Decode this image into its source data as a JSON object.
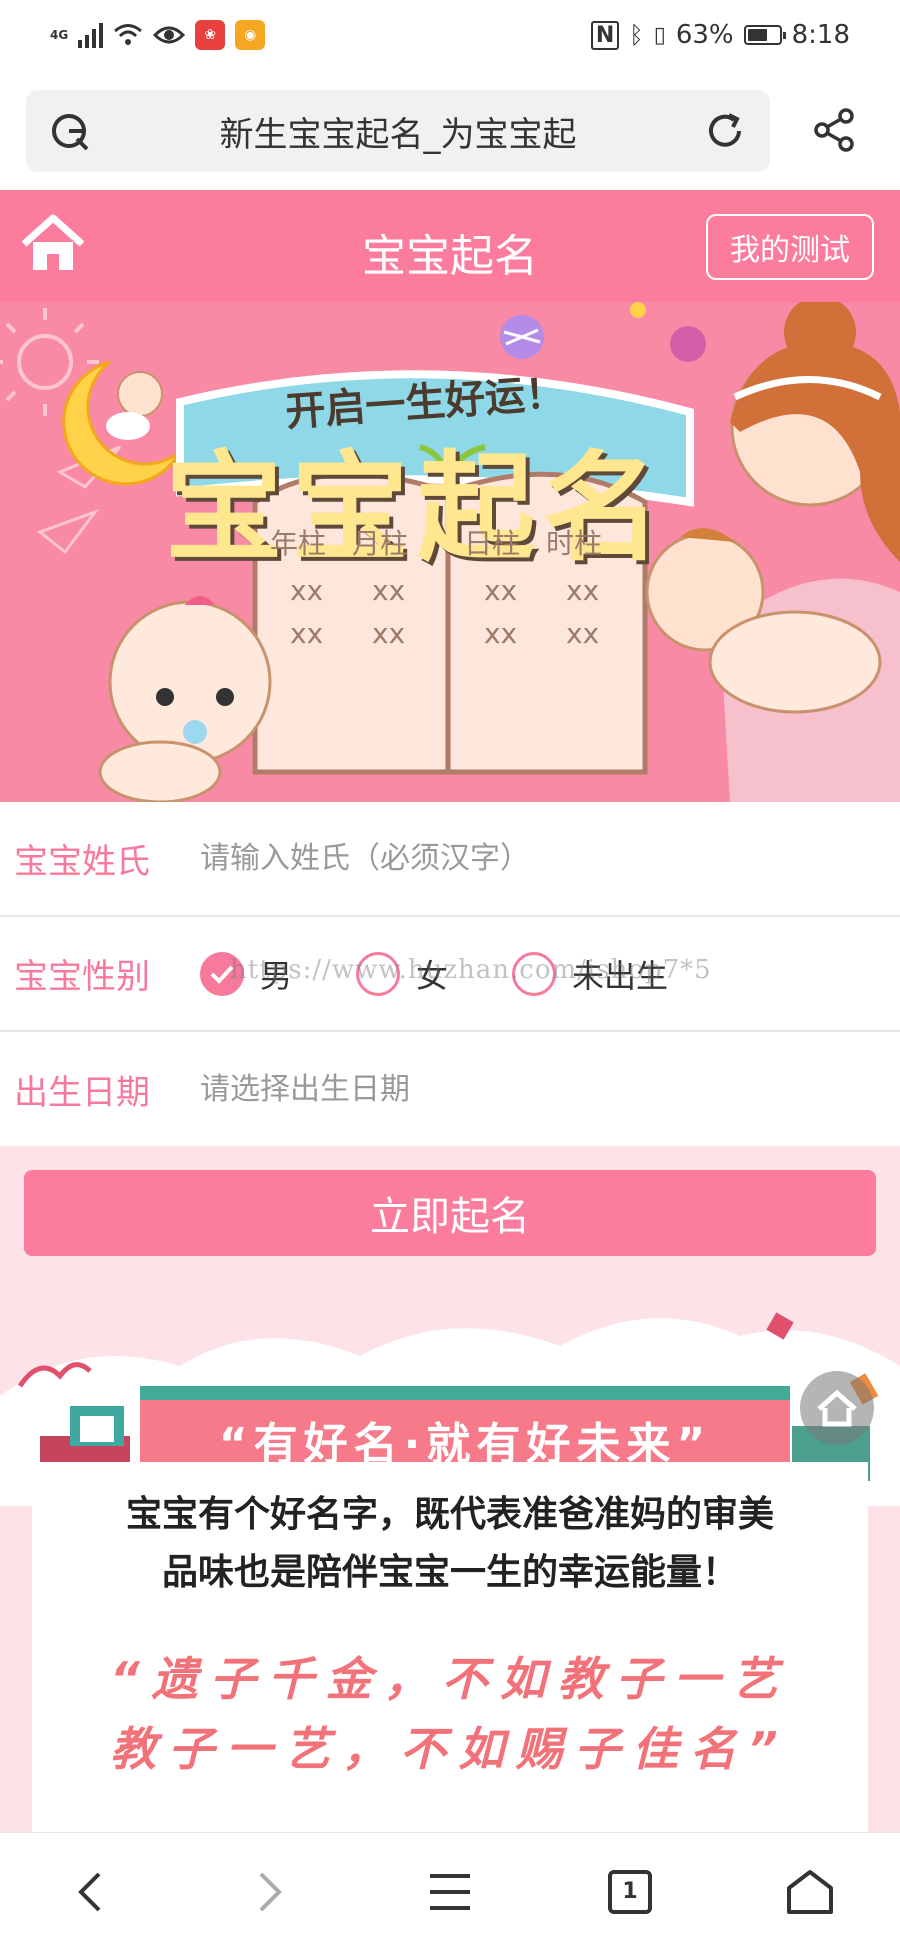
{
  "status_bar": {
    "network": "4G",
    "battery": "63%",
    "battery_level": 0.63,
    "time": "8:18"
  },
  "browser": {
    "page_title": "新生宝宝起名_为宝宝起"
  },
  "header": {
    "title": "宝宝起名",
    "my_test_label": "我的测试"
  },
  "banner": {
    "subtitle": "开启一生好运！",
    "title": "宝宝起名",
    "pillars": [
      "年柱",
      "月柱",
      "日柱",
      "时柱"
    ],
    "placeholder": "xx"
  },
  "form": {
    "surname_label": "宝宝姓氏",
    "surname_placeholder": "请输入姓氏（必须汉字）",
    "gender_label": "宝宝性别",
    "gender_options": [
      "男",
      "女",
      "未出生"
    ],
    "gender_selected": "男",
    "birthdate_label": "出生日期",
    "birthdate_placeholder": "请选择出生日期",
    "submit_label": "立即起名"
  },
  "watermark": "https://www.huzhan.com/ishop7*5",
  "promo": {
    "train_banner": "“有好名·就有好未来”",
    "intro_line1": "宝宝有个好名字，既代表准爸准妈的审美",
    "intro_line2": "品味也是陪伴宝宝一生的幸运能量！",
    "quote_line1": "“遗子千金，不如教子一艺",
    "quote_line2": "教子一艺，不如赐子佳名”"
  },
  "nav": {
    "tab_count": "1"
  },
  "colors": {
    "accent": "#fb7c9c",
    "label": "#f7799b",
    "quote": "#f2727a",
    "lower_bg": "#fde3e8"
  }
}
